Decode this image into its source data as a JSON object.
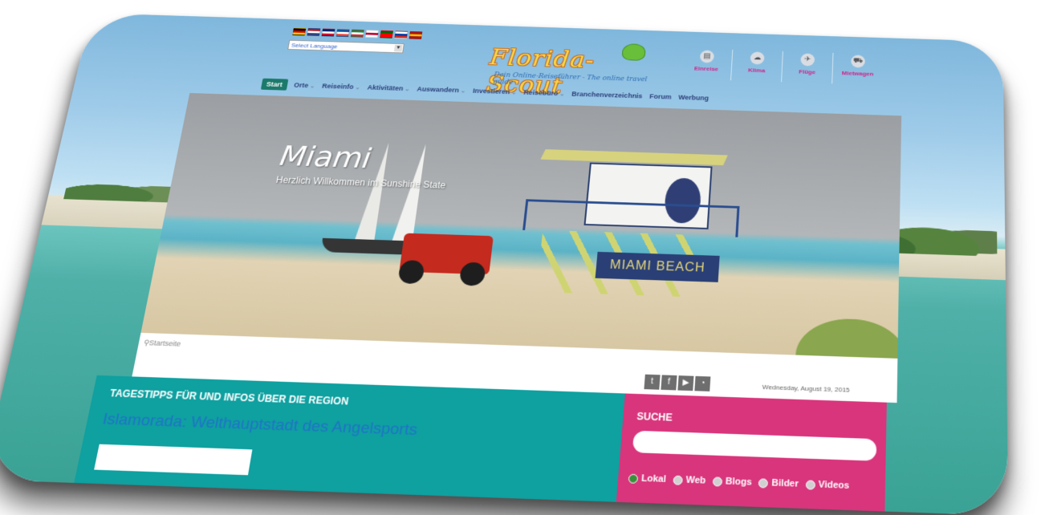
{
  "header": {
    "flags": [
      {
        "name": "german-flag",
        "colors": [
          "#000000",
          "#dd0000",
          "#ffce00"
        ]
      },
      {
        "name": "dutch-flag",
        "colors": [
          "#ae1c28",
          "#ffffff",
          "#21468b"
        ]
      },
      {
        "name": "uk-flag",
        "colors": [
          "#012169",
          "#ffffff",
          "#c8102e"
        ]
      },
      {
        "name": "french-flag",
        "colors": [
          "#0055a4",
          "#ffffff",
          "#ef4135"
        ]
      },
      {
        "name": "italian-flag",
        "colors": [
          "#009246",
          "#ffffff",
          "#ce2b37"
        ]
      },
      {
        "name": "japanese-flag",
        "colors": [
          "#ffffff",
          "#bc002d",
          "#ffffff"
        ]
      },
      {
        "name": "portuguese-flag",
        "colors": [
          "#006600",
          "#ff0000",
          "#ff0000"
        ]
      },
      {
        "name": "russian-flag",
        "colors": [
          "#ffffff",
          "#0039a6",
          "#d52b1e"
        ]
      },
      {
        "name": "spanish-flag",
        "colors": [
          "#aa151b",
          "#f1bf00",
          "#aa151b"
        ]
      }
    ],
    "language_select": "Select Language",
    "logo": {
      "text": "Florida-Scout",
      "tagline": "Dein Online-Reiseführer - The online travel guide"
    },
    "quick_links": [
      {
        "label": "Einreise",
        "icon": "passport-icon"
      },
      {
        "label": "Klima",
        "icon": "cloud-icon"
      },
      {
        "label": "Flüge",
        "icon": "plane-icon"
      },
      {
        "label": "Mietwagen",
        "icon": "car-icon"
      }
    ]
  },
  "nav": {
    "items": [
      {
        "label": "Start",
        "active": true,
        "dropdown": false
      },
      {
        "label": "Orte",
        "active": false,
        "dropdown": true
      },
      {
        "label": "Reiseinfo",
        "active": false,
        "dropdown": true
      },
      {
        "label": "Aktivitäten",
        "active": false,
        "dropdown": true
      },
      {
        "label": "Auswandern",
        "active": false,
        "dropdown": true
      },
      {
        "label": "Investieren",
        "active": false,
        "dropdown": true
      },
      {
        "label": "Reisebüro",
        "active": false,
        "dropdown": true
      },
      {
        "label": "Branchenverzeichnis",
        "active": false,
        "dropdown": false
      },
      {
        "label": "Forum",
        "active": false,
        "dropdown": false
      },
      {
        "label": "Werbung",
        "active": false,
        "dropdown": false
      }
    ]
  },
  "hero": {
    "title": "Miami",
    "subtitle": "Herzlich Willkommen im Sunshine State",
    "sign": "MIAMI BEACH"
  },
  "breadcrumb": "Startseite",
  "social": [
    "twitter-icon",
    "facebook-icon",
    "youtube-icon",
    "rss-icon"
  ],
  "date": "Wednesday, August 19, 2015",
  "tips": {
    "heading": "TAGESTIPPS FÜR UND INFOS ÜBER DIE REGION",
    "link": "Islamorada: Welthauptstadt des Angelsports"
  },
  "search": {
    "heading": "SUCHE",
    "placeholder": "",
    "options": [
      {
        "label": "Lokal",
        "checked": true
      },
      {
        "label": "Web",
        "checked": false
      },
      {
        "label": "Blogs",
        "checked": false
      },
      {
        "label": "Bilder",
        "checked": false
      },
      {
        "label": "Videos",
        "checked": false
      }
    ]
  },
  "colors": {
    "accent_teal": "#0fa0a0",
    "accent_pink": "#d8357c",
    "nav_active": "#1b7a6b",
    "link_pink": "#d3228a"
  }
}
